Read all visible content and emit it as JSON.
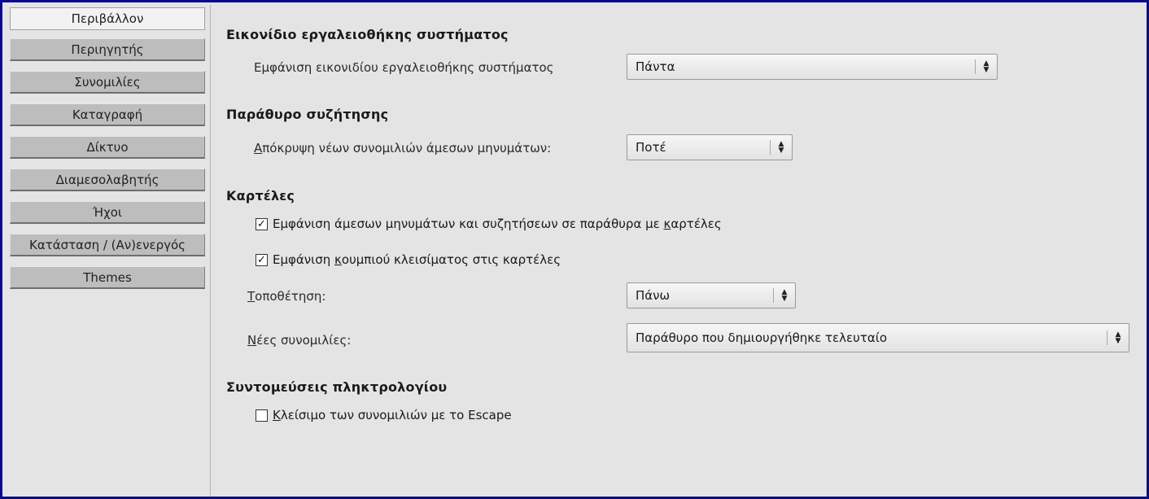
{
  "sidebar": {
    "tabs": [
      {
        "label": "Περιβάλλον",
        "active": true
      },
      {
        "label": "Περιηγητής",
        "active": false
      },
      {
        "label": "Συνομιλίες",
        "active": false
      },
      {
        "label": "Καταγραφή",
        "active": false
      },
      {
        "label": "Δίκτυο",
        "active": false
      },
      {
        "label": "Διαμεσολαβητής",
        "active": false
      },
      {
        "label": "Ήχοι",
        "active": false
      },
      {
        "label": "Κατάσταση / (Αν)ενεργός",
        "active": false
      },
      {
        "label": "Themes",
        "active": false
      }
    ]
  },
  "system_tray": {
    "title": "Εικονίδιο εργαλειοθήκης συστήματος",
    "show_label": "Εμφάνιση εικονιδίου εργαλειοθήκης συστήματος",
    "show_value": "Πάντα"
  },
  "conversation_window": {
    "title": "Παράθυρο συζήτησης",
    "hide_label_prefix": "Α",
    "hide_label_rest": "πόκρυψη νέων συνομιλιών άμεσων μηνυμάτων:",
    "hide_value": "Ποτέ"
  },
  "tabs_section": {
    "title": "Καρτέλες",
    "show_tabs_prefix": "Εμφάνιση άμεσων μηνυμάτων και συζητήσεων σε παράθυρα με ",
    "show_tabs_key": "κ",
    "show_tabs_rest": "αρτέλες",
    "show_tabs_checked": true,
    "close_btn_prefix": "Εμφάνιση ",
    "close_btn_key": "κ",
    "close_btn_rest": "ουμπιού κλεισίματος στις καρτέλες",
    "close_btn_checked": true,
    "placement_key": "Τ",
    "placement_rest": "οποθέτηση:",
    "placement_value": "Πάνω",
    "new_conv_key": "Ν",
    "new_conv_rest": "έες συνομιλίες:",
    "new_conv_value": "Παράθυρο που δημιουργήθηκε τελευταίο"
  },
  "shortcuts": {
    "title": "Συντομεύσεις πληκτρολογίου",
    "escape_key": "Κ",
    "escape_rest": "λείσιμο των συνομιλιών με το Escape",
    "escape_checked": false
  },
  "glyphs": {
    "check": "✓",
    "arrow_up": "▲",
    "arrow_down": "▼"
  }
}
